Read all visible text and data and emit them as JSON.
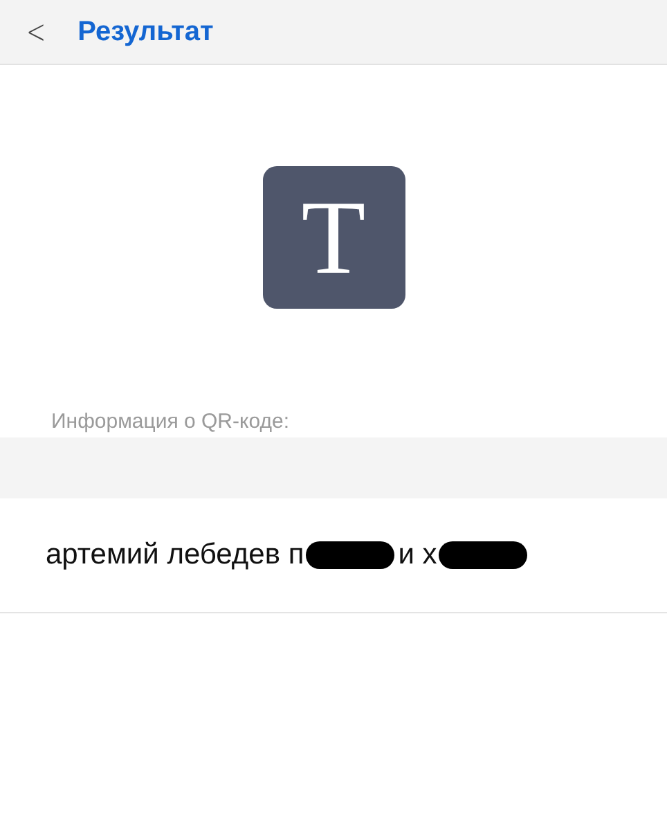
{
  "header": {
    "back": "<",
    "title": "Результат"
  },
  "type_icon": {
    "letter": "T"
  },
  "info_label": "Информация о QR-коде:",
  "content": [
    {
      "kind": "text",
      "text": "артемий лебедев п"
    },
    {
      "kind": "redaction"
    },
    {
      "kind": "text",
      "text": "и х"
    },
    {
      "kind": "redaction"
    }
  ]
}
